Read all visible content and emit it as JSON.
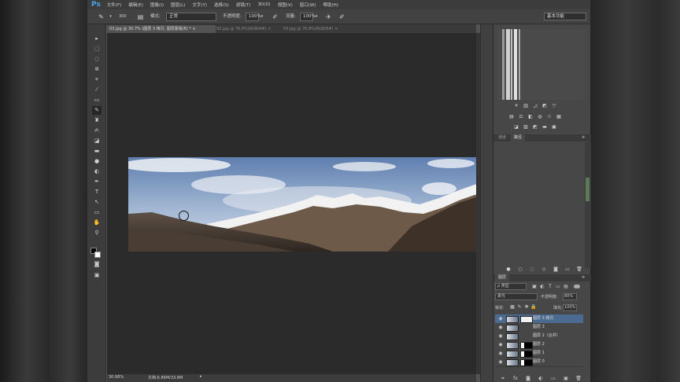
{
  "app": {
    "logo": "Ps"
  },
  "menu": [
    "文件(F)",
    "编辑(E)",
    "图像(I)",
    "图层(L)",
    "文字(Y)",
    "选择(S)",
    "滤镜(T)",
    "3D(D)",
    "视图(V)",
    "窗口(W)",
    "帮助(H)"
  ],
  "options": {
    "brush_size": "300",
    "mode_label": "模式:",
    "mode_value": "正常",
    "opacity_label": "不透明度:",
    "opacity_value": "100%",
    "flow_label": "流量:",
    "flow_value": "100%",
    "workspace": "基本功能"
  },
  "tabs": [
    {
      "label": "03.jpg @ 30.7% (图层 3 拷贝, 图层蒙版/8) *",
      "close": "×"
    },
    {
      "label": "02.jpg @ 76.8%(RGB/8#)",
      "close": "×"
    },
    {
      "label": "03.jpg @ 76.8%(RGB/8#)",
      "close": "×"
    }
  ],
  "status": {
    "zoom": "30.68%",
    "doc": "文档:6.86M/33.8M"
  },
  "panel_tabs": {
    "left": "通道",
    "right": "路径"
  },
  "layers_panel": {
    "title": "图层",
    "filter_label": "ρ 类型",
    "blend_mode": "柔光",
    "opacity_label": "不透明度:",
    "opacity_value": "80%",
    "lock_label": "锁定:",
    "fill_label": "填充:",
    "fill_value": "100%"
  },
  "layers": [
    {
      "name": "图层 3 拷贝",
      "selected": true,
      "mask": "light"
    },
    {
      "name": "图层 3",
      "selected": false,
      "mask": ""
    },
    {
      "name": "图层 2（合并）",
      "selected": false,
      "mask": ""
    },
    {
      "name": "图层 2",
      "selected": false,
      "mask": "dark"
    },
    {
      "name": "图层 1",
      "selected": false,
      "mask": "dark"
    },
    {
      "name": "图层 0",
      "selected": false,
      "mask": "dark"
    }
  ],
  "colors": {
    "accent": "#4aa3e8",
    "selection": "#4b6a90"
  }
}
